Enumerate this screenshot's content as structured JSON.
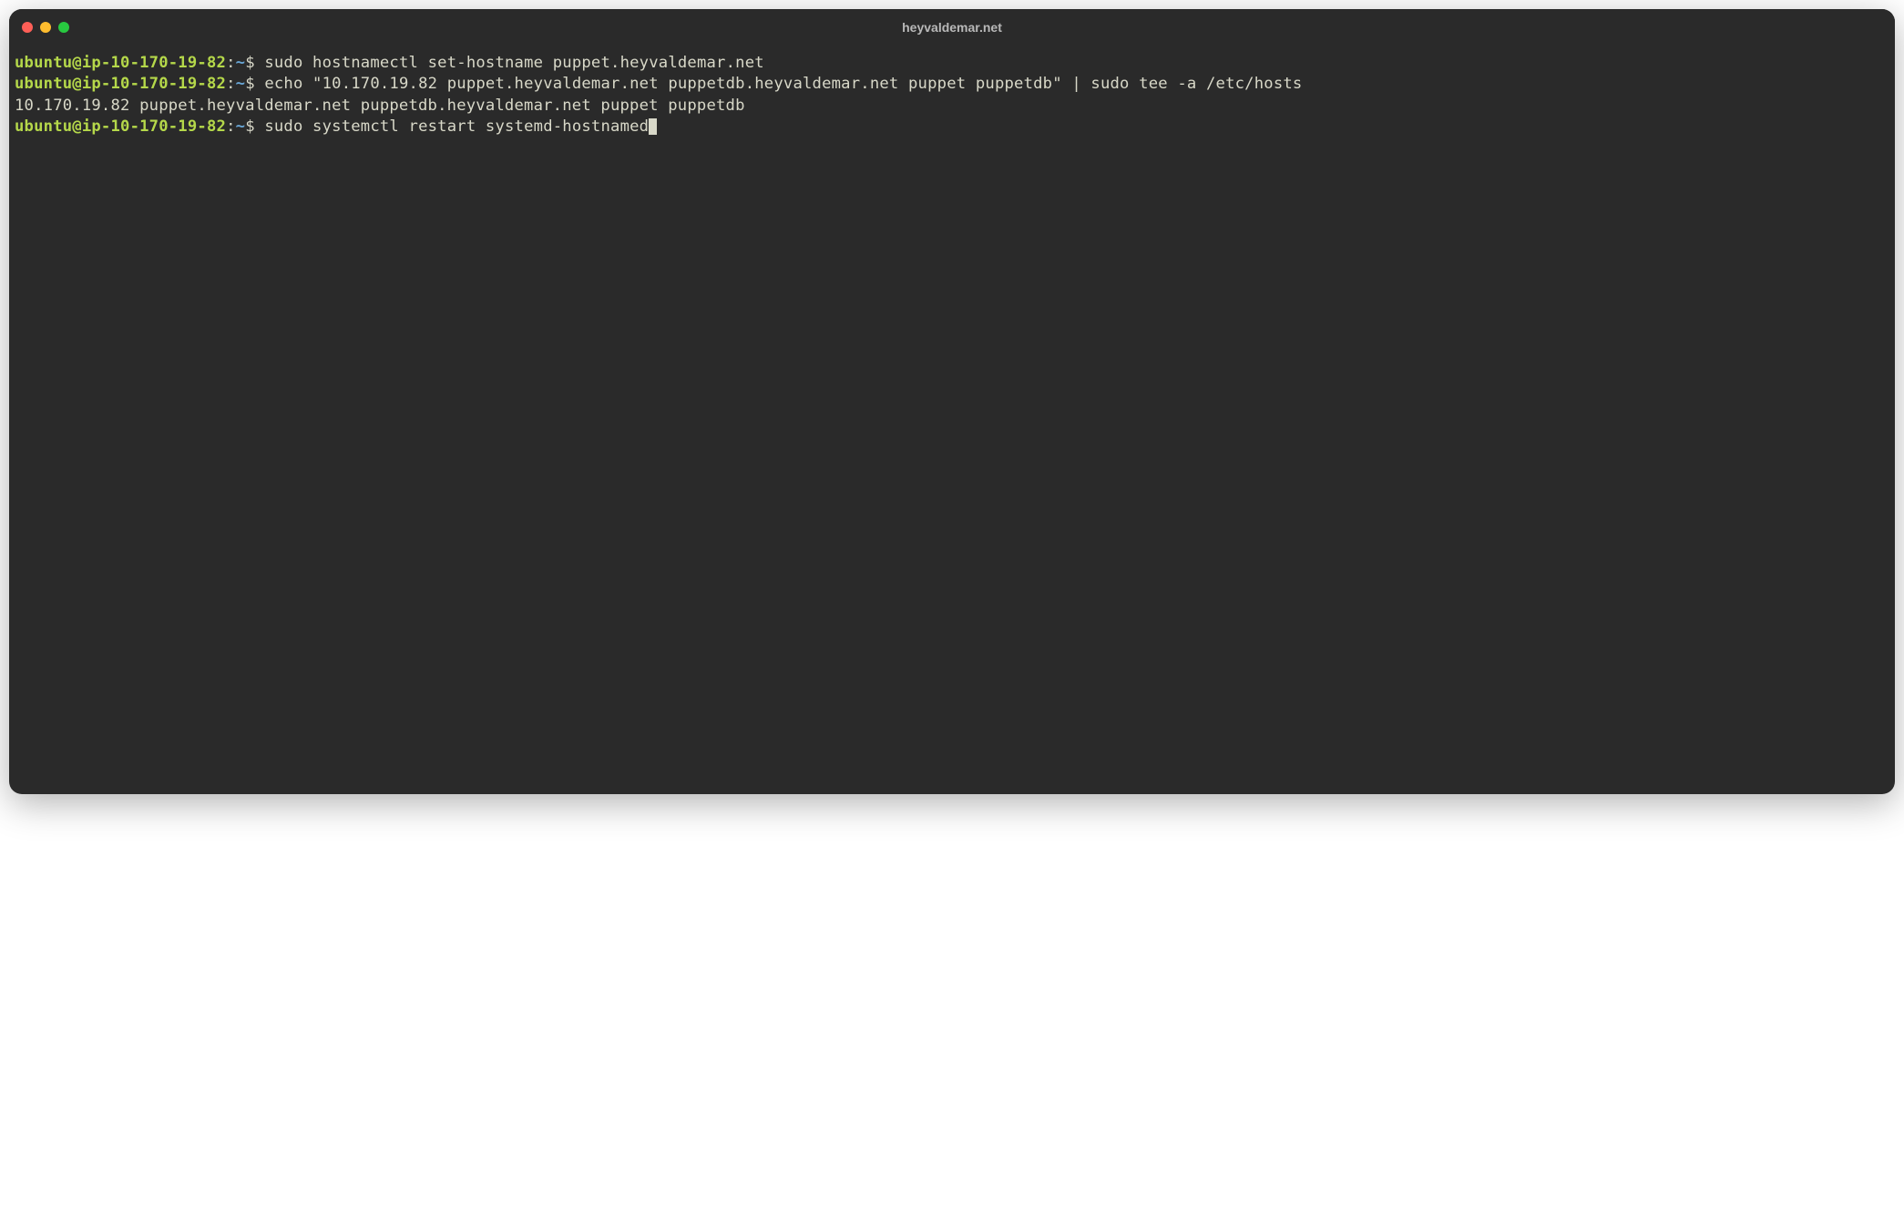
{
  "window": {
    "title": "heyvaldemar.net"
  },
  "prompt": {
    "user_host": "ubuntu@ip-10-170-19-82",
    "colon": ":",
    "path": "~",
    "dollar": "$"
  },
  "lines": {
    "line1_cmd": "sudo hostnamectl set-hostname puppet.heyvaldemar.net",
    "line2_cmd": "echo \"10.170.19.82 puppet.heyvaldemar.net puppetdb.heyvaldemar.net puppet puppetdb\" | sudo tee -a /etc/hosts",
    "line3_output": "10.170.19.82 puppet.heyvaldemar.net puppetdb.heyvaldemar.net puppet puppetdb",
    "line4_cmd": "sudo systemctl restart systemd-hostnamed"
  }
}
